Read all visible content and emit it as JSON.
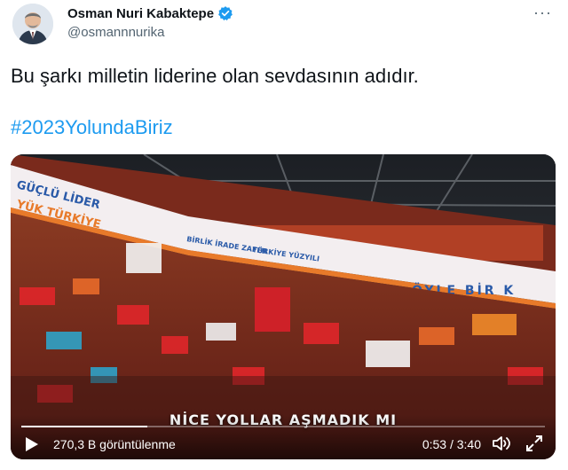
{
  "author": {
    "name": "Osman Nuri Kabaktepe",
    "handle": "@osmannnurika",
    "verified": true
  },
  "more_icon": "more-horizontal-icon",
  "tweet": {
    "text": "Bu şarkı milletin liderine olan sevdasının adıdır.",
    "hashtag": "#2023YolundaBiriz"
  },
  "video": {
    "caption": "NİCE YOLLAR AŞMADIK MI",
    "views": "270,3 B görüntülenme",
    "time": "0:53 / 3:40",
    "progress": 0.24,
    "banner_left": "GÜÇLÜ LİDER",
    "banner_left2": "YÜK TÜRKİYE",
    "banner_mid": "BİRLİK İRADE ZAFER",
    "banner_mid2": "TÜRKİYE YÜZYILI",
    "banner_right": "ÖYLE BİR K",
    "icons": [
      "play-icon",
      "volume-icon",
      "fullscreen-icon"
    ]
  },
  "colors": {
    "accent": "#1d9bf0",
    "verified": "#1d9bf0",
    "text": "#0f1419",
    "muted": "#536471"
  }
}
